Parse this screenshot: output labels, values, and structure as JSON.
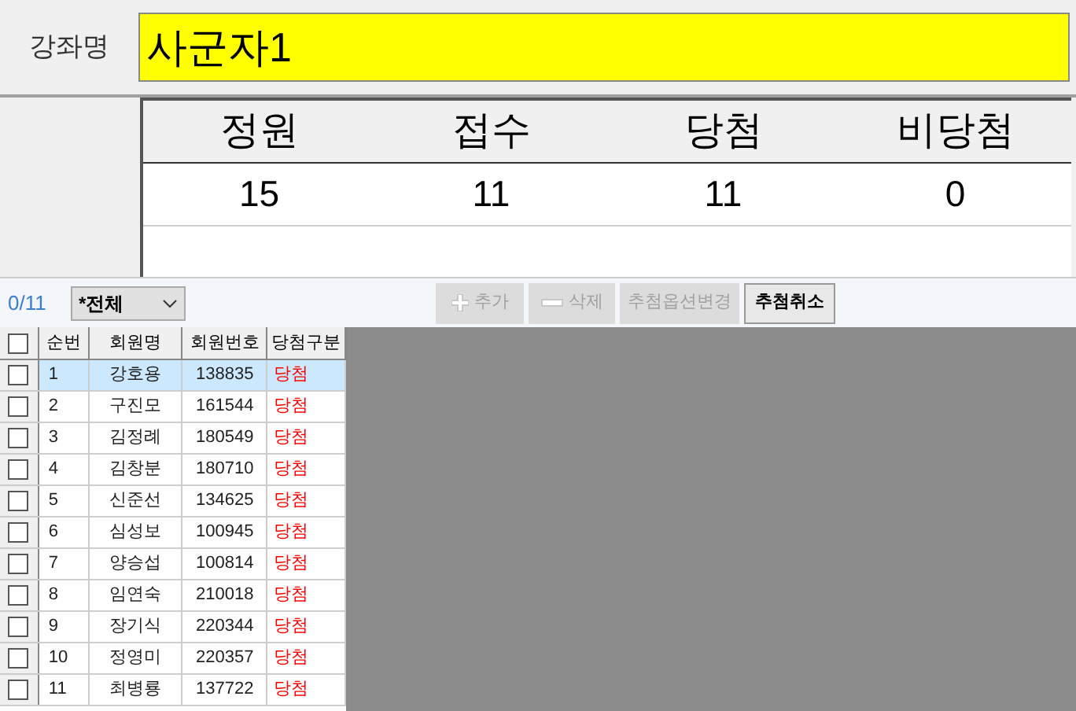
{
  "course": {
    "label": "강좌명",
    "value": "사군자1"
  },
  "summary": {
    "columns": [
      "정원",
      "접수",
      "당첨",
      "비당첨"
    ],
    "values": [
      "15",
      "11",
      "11",
      "0"
    ]
  },
  "toolbar": {
    "count": "0/11",
    "filter": "*전체",
    "buttons": [
      {
        "label": "추가",
        "kind": "add",
        "disabled": true
      },
      {
        "label": "삭제",
        "kind": "delete",
        "disabled": true
      },
      {
        "label": "추첨옵션변경",
        "kind": "text",
        "disabled": true
      },
      {
        "label": "추첨취소",
        "kind": "text",
        "disabled": false
      }
    ]
  },
  "table": {
    "header_checked": false,
    "columns": [
      "순번",
      "회원명",
      "회원번호",
      "당첨구분"
    ],
    "rows": [
      {
        "no": "1",
        "name": "강호용",
        "member_no": "138835",
        "result": "당첨",
        "checked": false,
        "selected": true
      },
      {
        "no": "2",
        "name": "구진모",
        "member_no": "161544",
        "result": "당첨",
        "checked": false,
        "selected": false
      },
      {
        "no": "3",
        "name": "김정례",
        "member_no": "180549",
        "result": "당첨",
        "checked": false,
        "selected": false
      },
      {
        "no": "4",
        "name": "김창분",
        "member_no": "180710",
        "result": "당첨",
        "checked": false,
        "selected": false
      },
      {
        "no": "5",
        "name": "신준선",
        "member_no": "134625",
        "result": "당첨",
        "checked": false,
        "selected": false
      },
      {
        "no": "6",
        "name": "심성보",
        "member_no": "100945",
        "result": "당첨",
        "checked": false,
        "selected": false
      },
      {
        "no": "7",
        "name": "양승섭",
        "member_no": "100814",
        "result": "당첨",
        "checked": false,
        "selected": false
      },
      {
        "no": "8",
        "name": "임연숙",
        "member_no": "210018",
        "result": "당첨",
        "checked": false,
        "selected": false
      },
      {
        "no": "9",
        "name": "장기식",
        "member_no": "220344",
        "result": "당첨",
        "checked": false,
        "selected": false
      },
      {
        "no": "10",
        "name": "정영미",
        "member_no": "220357",
        "result": "당첨",
        "checked": false,
        "selected": false
      },
      {
        "no": "11",
        "name": "최병룡",
        "member_no": "137722",
        "result": "당첨",
        "checked": false,
        "selected": false
      }
    ]
  }
}
